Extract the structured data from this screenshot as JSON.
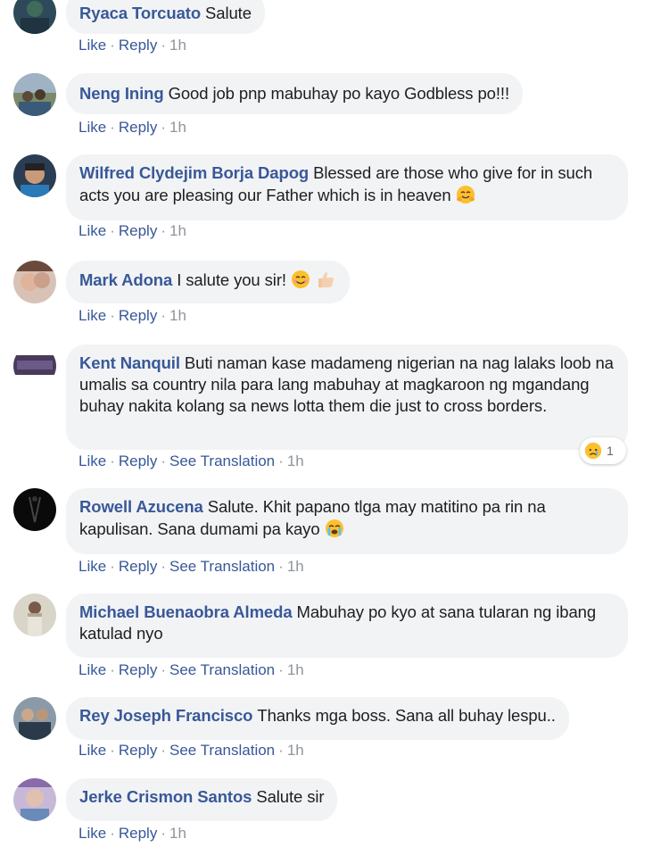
{
  "labels": {
    "like": "Like",
    "reply": "Reply",
    "see_translation": "See Translation",
    "separator": "·"
  },
  "comments": [
    {
      "author": "Ryaca Torcuato",
      "text": "Salute",
      "time": "1h"
    },
    {
      "author": "Neng Ining",
      "text": "Good job pnp mabuhay po kayo Godbless po!!!",
      "time": "1h"
    },
    {
      "author": "Wilfred Clydejim Borja Dapog",
      "text": "Blessed are those who give for in such acts you are pleasing our Father which is in heaven",
      "emoji": "hugging-face-icon",
      "time": "1h"
    },
    {
      "author": "Mark Adona",
      "text": "I salute you sir!",
      "emoji": "smiling-face-icon",
      "emoji2": "thumbs-up-icon",
      "time": "1h"
    },
    {
      "author": "Kent Nanquil",
      "text": "Buti naman kase madameng nigerian na nag lalaks loob na umalis sa country nila para lang mabuhay at magkaroon ng mgandang buhay nakita kolang sa news lotta them die just to cross borders.",
      "time": "1h",
      "reaction": {
        "icon": "sad-reaction-icon",
        "count": "1"
      }
    },
    {
      "author": "Rowell Azucena",
      "text": "Salute. Khit papano tlga may matitino pa rin na kapulisan. Sana dumami pa kayo",
      "emoji": "crying-face-icon",
      "time": "1h"
    },
    {
      "author": "Michael Buenaobra Almeda",
      "text": "Mabuhay po kyo at sana tularan ng ibang katulad nyo",
      "time": "1h"
    },
    {
      "author": "Rey Joseph Francisco",
      "text": "Thanks mga boss. Sana all buhay lespu..",
      "time": "1h"
    },
    {
      "author": "Jerke Crismon Santos",
      "text": "Salute sir",
      "time": "1h"
    }
  ],
  "colors": {
    "link": "#385898",
    "text": "#1c1e21",
    "meta": "#90949c",
    "bubble": "#f2f3f5"
  }
}
